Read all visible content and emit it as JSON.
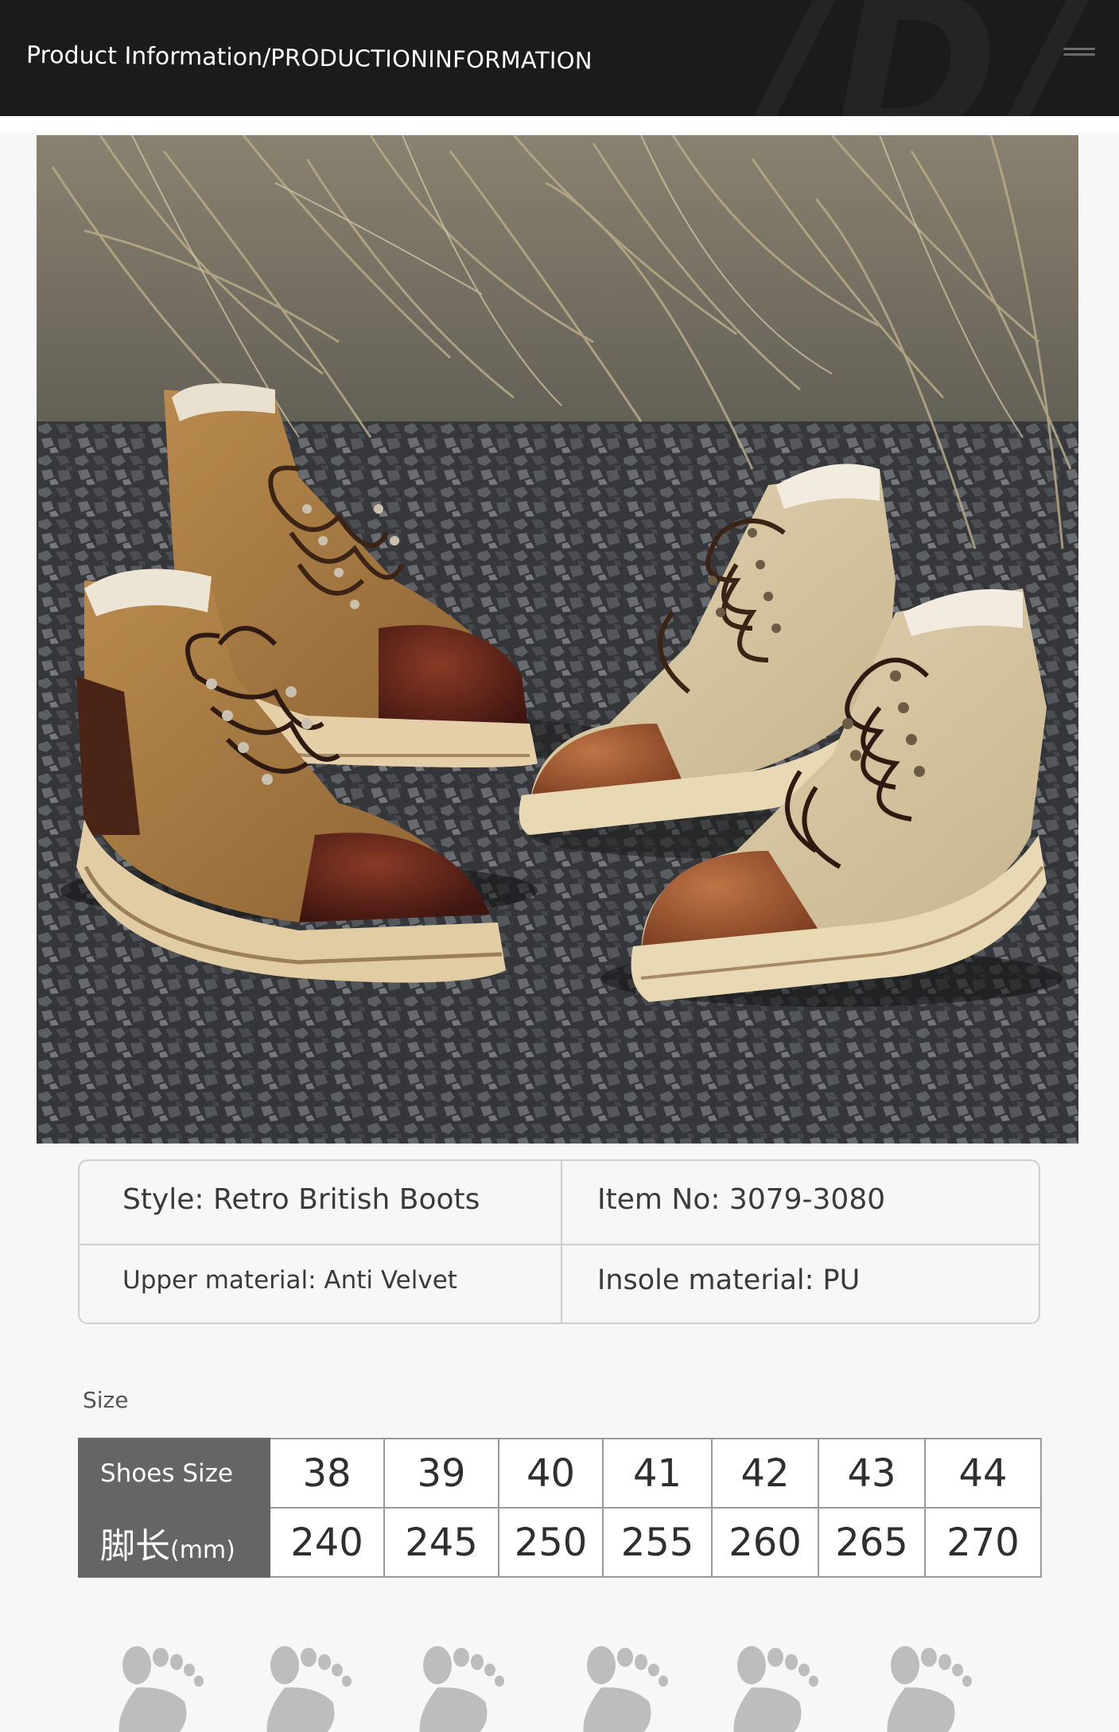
{
  "header": {
    "title_main": "Product Information/",
    "title_sub": "PRODUCTIONINFORMATION",
    "menu_icon": "menu-icon"
  },
  "photo": {
    "subject": "product-photo-boots",
    "icon": "image"
  },
  "spec": {
    "style": "Style: Retro British Boots",
    "item_no": "Item No: 3079-3080",
    "upper_material": "Upper material: Anti Velvet",
    "insole_material": "Insole material: PU"
  },
  "size": {
    "label": "Size",
    "row1_header": "Shoes Size",
    "row2_header_main": "脚长",
    "row2_header_unit": "(mm)",
    "sizes": [
      "38",
      "39",
      "40",
      "41",
      "42",
      "43",
      "44"
    ],
    "lengths": [
      "240",
      "245",
      "250",
      "255",
      "260",
      "265",
      "270"
    ]
  },
  "footprints": {
    "icon": "footprint-icon",
    "color": "#bdbdbd"
  }
}
